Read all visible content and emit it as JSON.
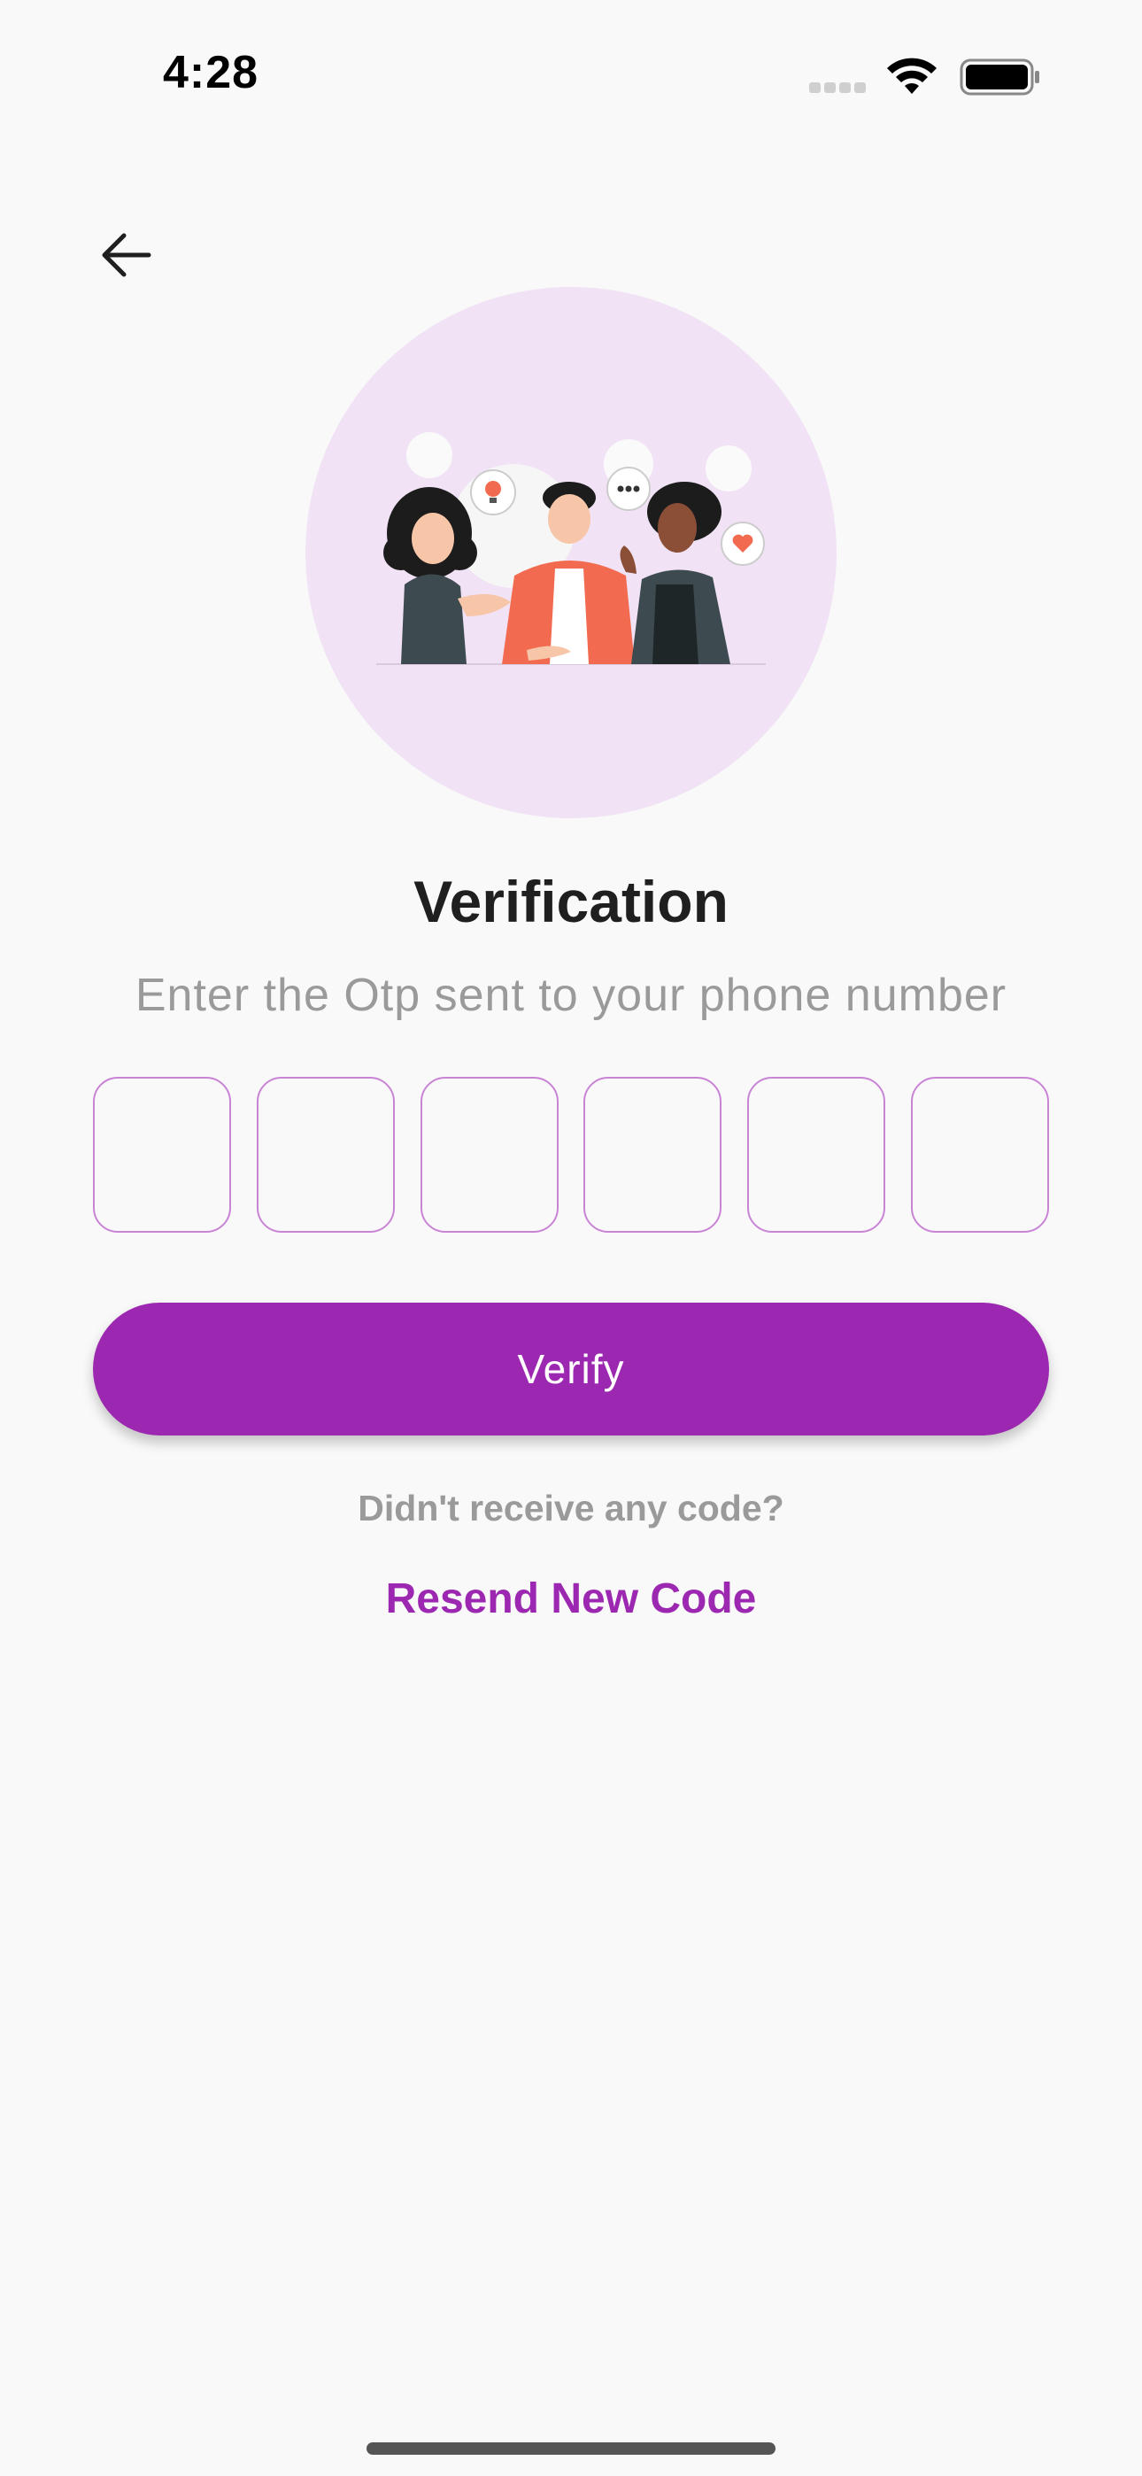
{
  "status_bar": {
    "time": "4:28",
    "icons": [
      "cellular-signal-icon",
      "wifi-icon",
      "battery-icon"
    ]
  },
  "header": {
    "back_icon": "arrow-left-icon"
  },
  "hero": {
    "illustration": "three-people-chatting-illustration"
  },
  "main": {
    "title": "Verification",
    "subtitle": "Enter the Otp sent to your phone number",
    "otp_fields": [
      "",
      "",
      "",
      "",
      "",
      ""
    ],
    "verify_label": "Verify",
    "no_code_text": "Didn't receive any code?",
    "resend_label": "Resend New Code"
  },
  "colors": {
    "primary": "#9c27b0",
    "otp_border": "#c984d6",
    "hero_circle": "#f1e3f5",
    "background": "#f9f9f9"
  }
}
